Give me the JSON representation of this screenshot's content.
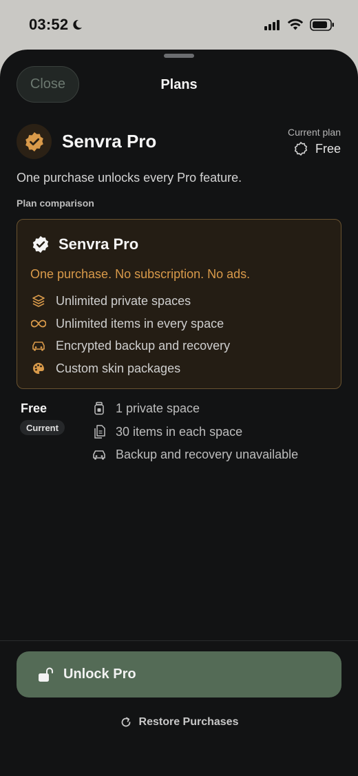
{
  "status_bar": {
    "time": "03:52"
  },
  "header": {
    "close_label": "Close",
    "title": "Plans"
  },
  "product": {
    "name": "Senvra Pro",
    "current_plan_label": "Current plan",
    "current_plan_value": "Free",
    "tagline": "One purchase unlocks every Pro feature."
  },
  "comparison": {
    "section_label": "Plan comparison",
    "pro": {
      "title": "Senvra Pro",
      "subtitle": "One purchase. No subscription. No ads.",
      "features": [
        {
          "icon": "layers-icon",
          "label": "Unlimited private spaces"
        },
        {
          "icon": "infinity-icon",
          "label": "Unlimited items in every space"
        },
        {
          "icon": "car-icon",
          "label": "Encrypted backup and recovery"
        },
        {
          "icon": "palette-icon",
          "label": "Custom skin packages"
        }
      ]
    },
    "free": {
      "title": "Free",
      "badge": "Current",
      "features": [
        {
          "icon": "jar-icon",
          "label": "1 private space"
        },
        {
          "icon": "documents-icon",
          "label": "30 items in each space"
        },
        {
          "icon": "car-icon",
          "label": "Backup and recovery unavailable"
        }
      ]
    }
  },
  "actions": {
    "unlock_label": "Unlock Pro",
    "restore_label": "Restore Purchases"
  },
  "colors": {
    "accent_gold": "#d99a4a",
    "button_green": "#546b56",
    "sheet_bg": "#121314"
  }
}
